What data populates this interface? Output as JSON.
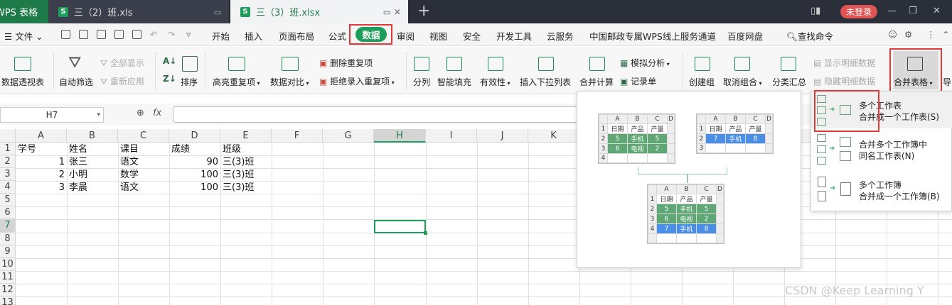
{
  "titlebar": {
    "app_tab": "WPS 表格",
    "tab1": "三（2）班.xls",
    "tab2": "三（3）班.xlsx",
    "login": "未登录"
  },
  "menu": {
    "file": "文件",
    "items": [
      "开始",
      "插入",
      "页面布局",
      "公式",
      "数据",
      "审阅",
      "视图",
      "安全",
      "开发工具",
      "云服务",
      "中国邮政专属WPS线上服务通道",
      "百度网盘"
    ],
    "active": "数据",
    "search": "查找命令"
  },
  "ribbon": {
    "pivot": "数据透视表",
    "autofilter": "自动筛选",
    "showall": "全部显示",
    "reapply": "重新应用",
    "sort": "排序",
    "highlight_dup": "高亮重复项",
    "compare": "数据对比",
    "delete_dup": "删除重复项",
    "reject_dup": "拒绝录入重复项",
    "split": "分列",
    "flash_fill": "智能填充",
    "validity": "有效性",
    "dropdown_list": "插入下拉列表",
    "consolidate": "合并计算",
    "whatif": "模拟分析",
    "record": "记录单",
    "group": "创建组",
    "ungroup": "取消组合",
    "subtotal": "分类汇总",
    "show_detail": "显示明细数据",
    "hide_detail": "隐藏明细数据",
    "merge_tables": "合并表格",
    "export": "导"
  },
  "formula": {
    "namebox": "H7",
    "fx": "fx"
  },
  "sheet": {
    "columns": [
      "A",
      "B",
      "C",
      "D",
      "E",
      "F",
      "G",
      "H",
      "I",
      "J",
      "K"
    ],
    "rows": [
      "1",
      "2",
      "3",
      "4",
      "5",
      "6",
      "7",
      "8",
      "9",
      "10",
      "11",
      "12",
      "13"
    ],
    "header": [
      "学号",
      "姓名",
      "课目",
      "成绩",
      "班级"
    ],
    "data": [
      [
        "1",
        "张三",
        "语文",
        "90",
        "三(3)班"
      ],
      [
        "2",
        "小明",
        "数学",
        "100",
        "三(3)班"
      ],
      [
        "3",
        "李晨",
        "语文",
        "100",
        "三(3)班"
      ]
    ]
  },
  "preview": {
    "cols": [
      "A",
      "B",
      "C",
      "D"
    ],
    "headers": [
      "日期",
      "产品",
      "产量"
    ],
    "t1": [
      [
        "5",
        "手机",
        "5"
      ],
      [
        "6",
        "电视",
        "2"
      ]
    ],
    "t2": [
      [
        "7",
        "手机",
        "8"
      ]
    ],
    "t3": [
      [
        "5",
        "手机",
        "5"
      ],
      [
        "6",
        "电视",
        "2"
      ],
      [
        "7",
        "手机",
        "8"
      ]
    ]
  },
  "dropdown": {
    "item1_title": "多个工作表",
    "item1_sub": "合并成一个工作表(S)",
    "item2_title": "合并多个工作簿中",
    "item2_sub": "同名工作表(N)",
    "item3_title": "多个工作簿",
    "item3_sub": "合并成一个工作簿(B)"
  },
  "watermark": "CSDN @Keep Learning Y",
  "colors": {
    "accent": "#1e9e5a",
    "highlight_red": "#e23a3a",
    "login": "#e05353"
  }
}
